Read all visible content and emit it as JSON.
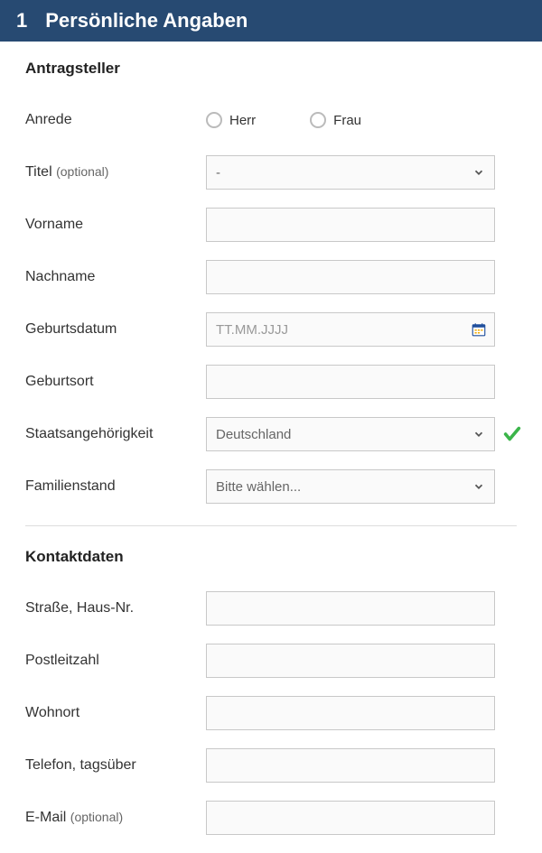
{
  "header": {
    "number": "1",
    "title": "Persönliche Angaben"
  },
  "section1": {
    "title": "Antragsteller",
    "fields": {
      "anrede": {
        "label": "Anrede",
        "option1": "Herr",
        "option2": "Frau"
      },
      "titel": {
        "label": "Titel ",
        "optional": "(optional)",
        "value": "-"
      },
      "vorname": {
        "label": "Vorname",
        "value": ""
      },
      "nachname": {
        "label": "Nachname",
        "value": ""
      },
      "geburtsdatum": {
        "label": "Geburtsdatum",
        "placeholder": "TT.MM.JJJJ"
      },
      "geburtsort": {
        "label": "Geburtsort",
        "value": ""
      },
      "staat": {
        "label": "Staatsangehörigkeit",
        "value": "Deutschland"
      },
      "familienstand": {
        "label": "Familienstand",
        "value": "Bitte wählen..."
      }
    }
  },
  "section2": {
    "title": "Kontaktdaten",
    "fields": {
      "strasse": {
        "label": "Straße, Haus-Nr.",
        "value": ""
      },
      "plz": {
        "label": "Postleitzahl",
        "value": ""
      },
      "wohnort": {
        "label": "Wohnort",
        "value": ""
      },
      "telefon": {
        "label": "Telefon, tagsüber",
        "value": ""
      },
      "email": {
        "label": "E-Mail ",
        "optional": "(optional)",
        "value": ""
      }
    }
  }
}
